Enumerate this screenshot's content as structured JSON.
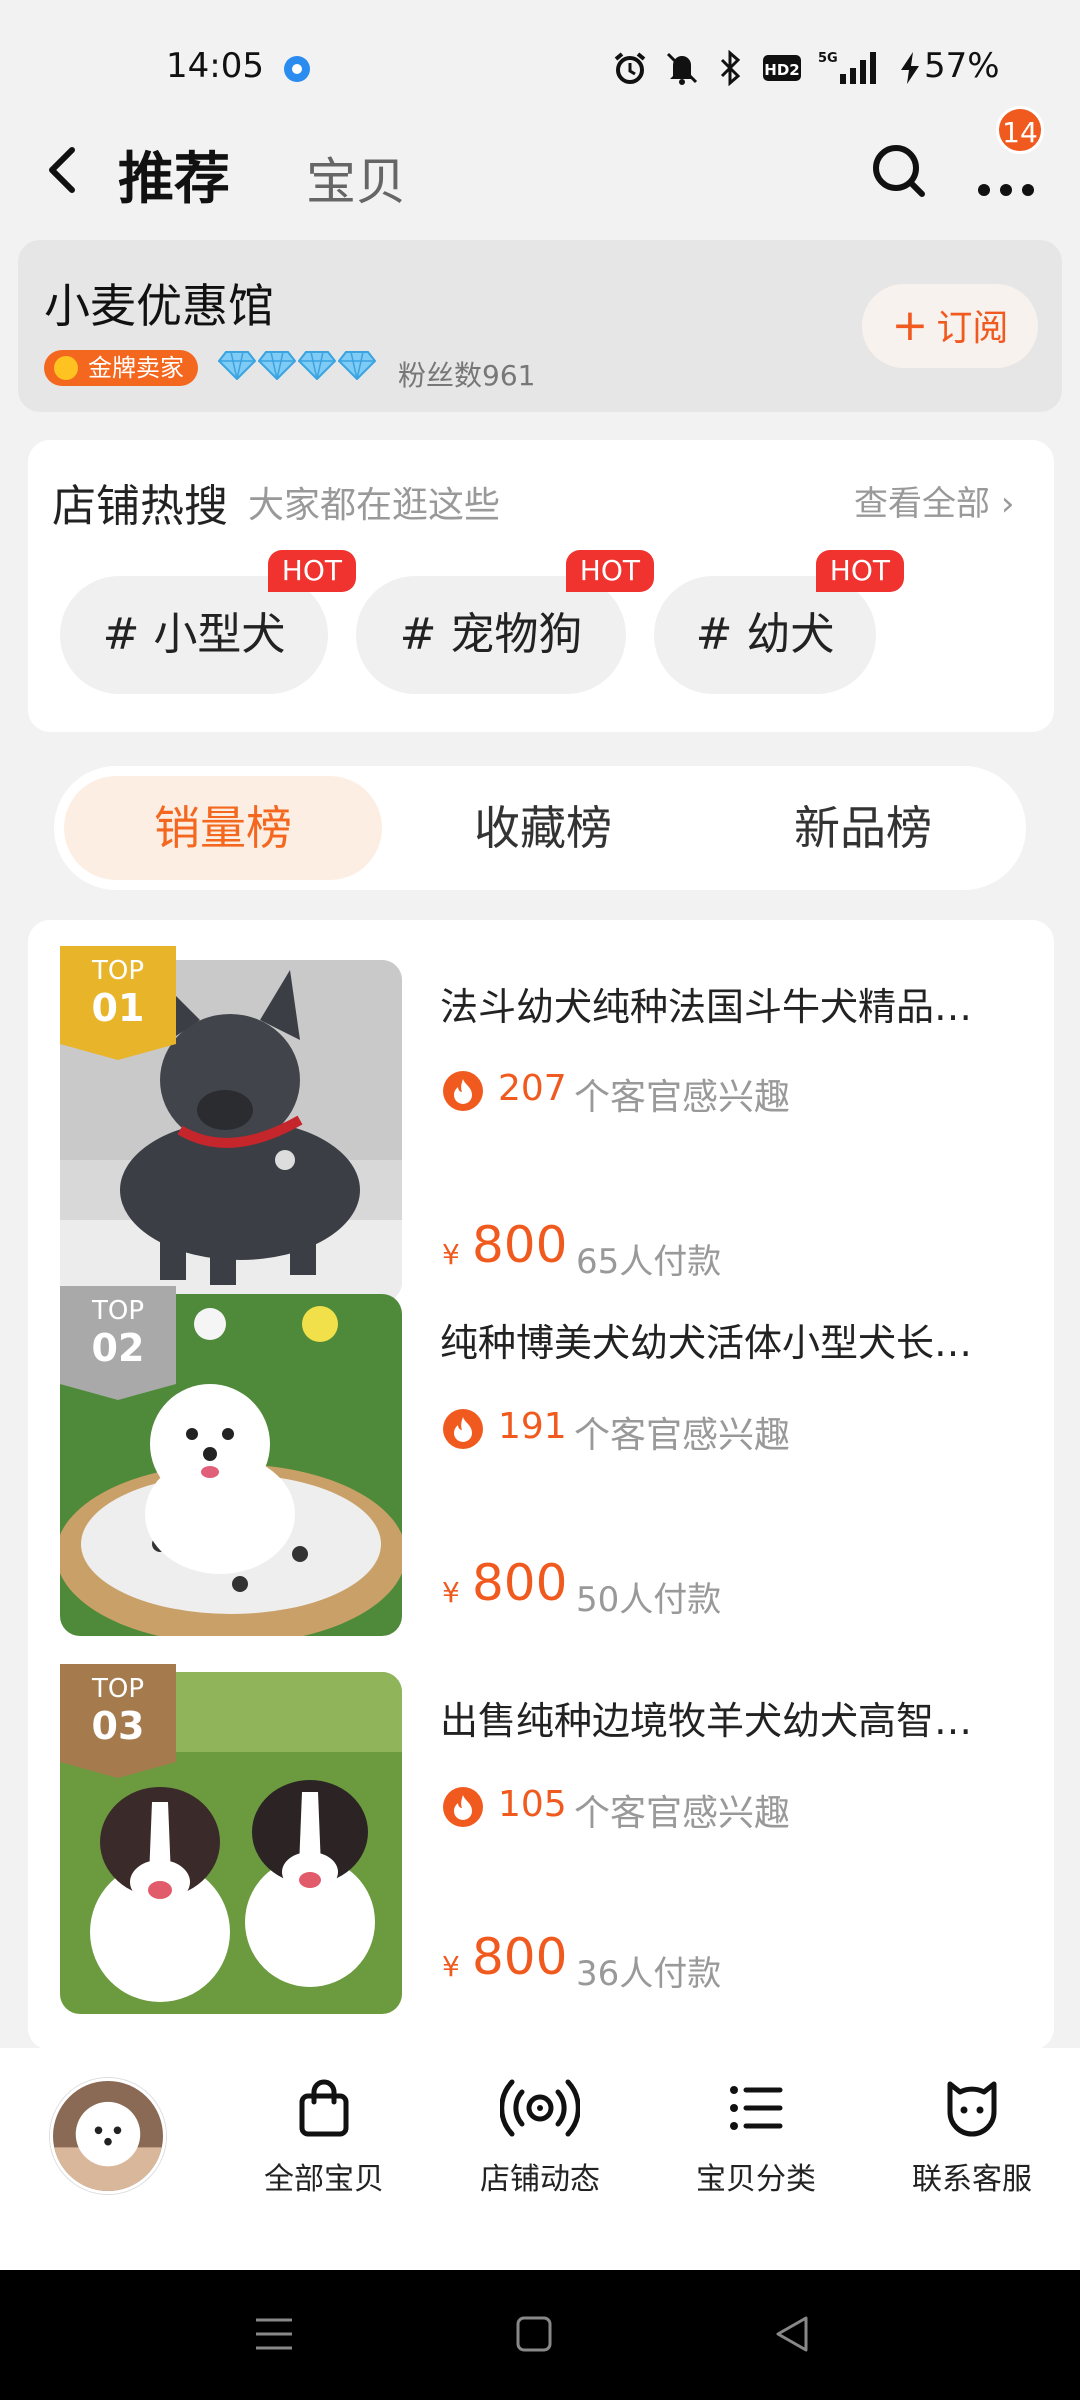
{
  "status": {
    "time": "14:05",
    "battery": "57%"
  },
  "nav": {
    "tab_active": "推荐",
    "tab_other": "宝贝",
    "message_count": "14"
  },
  "shop": {
    "name": "小麦优惠馆",
    "seller_badge": "金牌卖家",
    "fans": "粉丝数961",
    "subscribe_label": "订阅"
  },
  "hot_search": {
    "title": "店铺热搜",
    "subtitle": "大家都在逛这些",
    "see_all": "查看全部",
    "hot_label": "HOT",
    "tags": [
      "# 小型犬",
      "# 宠物狗",
      "# 幼犬"
    ]
  },
  "rank_tabs": [
    "销量榜",
    "收藏榜",
    "新品榜"
  ],
  "products": [
    {
      "rank_label": "TOP",
      "rank_num": "01",
      "title": "法斗幼犬纯种法国斗牛犬精品…",
      "interest_num": "207",
      "interest_text": "个客官感兴趣",
      "currency": "¥",
      "price": "800",
      "paid": "65人付款"
    },
    {
      "rank_label": "TOP",
      "rank_num": "02",
      "title": "纯种博美犬幼犬活体小型犬长…",
      "interest_num": "191",
      "interest_text": "个客官感兴趣",
      "currency": "¥",
      "price": "800",
      "paid": "50人付款"
    },
    {
      "rank_label": "TOP",
      "rank_num": "03",
      "title": "出售纯种边境牧羊犬幼犬高智…",
      "interest_num": "105",
      "interest_text": "个客官感兴趣",
      "currency": "¥",
      "price": "800",
      "paid": "36人付款"
    }
  ],
  "bottom_bar": [
    "全部宝贝",
    "店铺动态",
    "宝贝分类",
    "联系客服"
  ],
  "colors": {
    "accent": "#f05a1f",
    "hot": "#f0332e",
    "gold": "#e8b42a",
    "silver": "#a9a9a9",
    "bronze": "#a57a4c"
  }
}
